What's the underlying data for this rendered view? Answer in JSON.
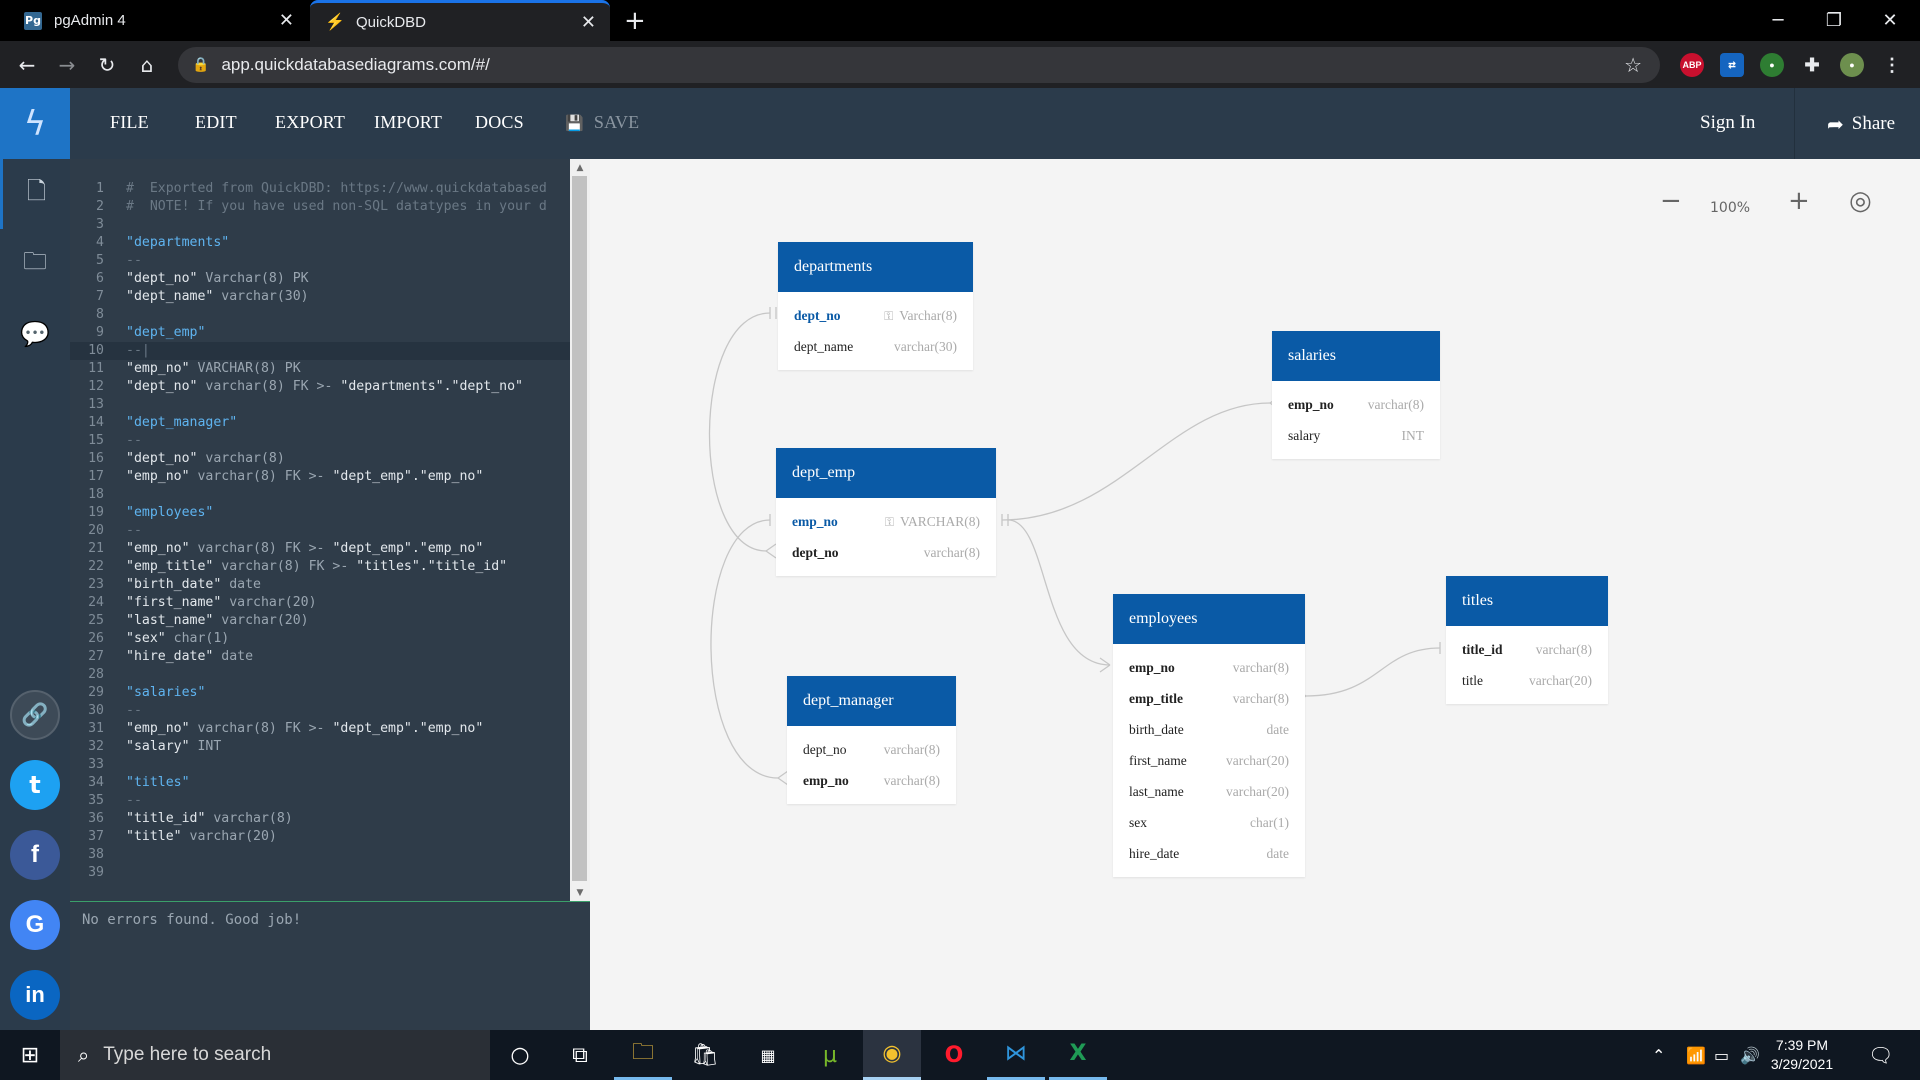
{
  "browser": {
    "tabs": [
      {
        "label": "pgAdmin 4",
        "favicon": "pg"
      },
      {
        "label": "QuickDBD",
        "favicon": "quickdbd-bolt"
      }
    ],
    "url": "app.quickdatabasediagrams.com/#/"
  },
  "app": {
    "menu": {
      "file": "FILE",
      "edit": "EDIT",
      "export": "EXPORT",
      "import": "IMPORT",
      "docs": "DOCS",
      "save": "SAVE"
    },
    "sign_in": "Sign In",
    "share": "Share",
    "accent_color": "#1e74c6",
    "header_color": "#2b3b4b",
    "table_header_color": "#0a5aa6"
  },
  "editor": {
    "lines": [
      [
        [
          "com",
          "#  Exported from QuickDBD: https://www.quickdatabased"
        ]
      ],
      [
        [
          "com",
          "#  NOTE! If you have used non-SQL datatypes in your d"
        ]
      ],
      [],
      [
        [
          "tbl",
          "\"departments\""
        ]
      ],
      [
        [
          "dash",
          "--"
        ]
      ],
      [
        [
          "str",
          "\"dept_no\" "
        ],
        [
          "type",
          "Varchar(8) PK"
        ]
      ],
      [
        [
          "str",
          "\"dept_name\" "
        ],
        [
          "type",
          "varchar(30)"
        ]
      ],
      [],
      [
        [
          "tbl",
          "\"dept_emp\""
        ]
      ],
      [
        [
          "dash",
          "--|"
        ]
      ],
      [
        [
          "str",
          "\"emp_no\" "
        ],
        [
          "type",
          "VARCHAR(8) PK"
        ]
      ],
      [
        [
          "str",
          "\"dept_no\" "
        ],
        [
          "type",
          "varchar(8) FK >- "
        ],
        [
          "str",
          "\"departments\".\"dept_no\""
        ]
      ],
      [],
      [
        [
          "tbl",
          "\"dept_manager\""
        ]
      ],
      [
        [
          "dash",
          "--"
        ]
      ],
      [
        [
          "str",
          "\"dept_no\" "
        ],
        [
          "type",
          "varchar(8)"
        ]
      ],
      [
        [
          "str",
          "\"emp_no\" "
        ],
        [
          "type",
          "varchar(8) FK >- "
        ],
        [
          "str",
          "\"dept_emp\".\"emp_no\""
        ]
      ],
      [],
      [
        [
          "tbl",
          "\"employees\""
        ]
      ],
      [
        [
          "dash",
          "--"
        ]
      ],
      [
        [
          "str",
          "\"emp_no\" "
        ],
        [
          "type",
          "varchar(8) FK >- "
        ],
        [
          "str",
          "\"dept_emp\".\"emp_no\""
        ]
      ],
      [
        [
          "str",
          "\"emp_title\" "
        ],
        [
          "type",
          "varchar(8) FK >- "
        ],
        [
          "str",
          "\"titles\".\"title_id\""
        ]
      ],
      [
        [
          "str",
          "\"birth_date\" "
        ],
        [
          "type",
          "date"
        ]
      ],
      [
        [
          "str",
          "\"first_name\" "
        ],
        [
          "type",
          "varchar(20)"
        ]
      ],
      [
        [
          "str",
          "\"last_name\" "
        ],
        [
          "type",
          "varchar(20)"
        ]
      ],
      [
        [
          "str",
          "\"sex\" "
        ],
        [
          "type",
          "char(1)"
        ]
      ],
      [
        [
          "str",
          "\"hire_date\" "
        ],
        [
          "type",
          "date"
        ]
      ],
      [],
      [
        [
          "tbl",
          "\"salaries\""
        ]
      ],
      [
        [
          "dash",
          "--"
        ]
      ],
      [
        [
          "str",
          "\"emp_no\" "
        ],
        [
          "type",
          "varchar(8) FK >- "
        ],
        [
          "str",
          "\"dept_emp\".\"emp_no\""
        ]
      ],
      [
        [
          "str",
          "\"salary\" "
        ],
        [
          "type",
          "INT"
        ]
      ],
      [],
      [
        [
          "tbl",
          "\"titles\""
        ]
      ],
      [
        [
          "dash",
          "--"
        ]
      ],
      [
        [
          "str",
          "\"title_id\" "
        ],
        [
          "type",
          "varchar(8)"
        ]
      ],
      [
        [
          "str",
          "\"title\" "
        ],
        [
          "type",
          "varchar(20)"
        ]
      ],
      [],
      []
    ],
    "highlighted_line": 10,
    "status_message": "No errors found. Good job!"
  },
  "canvas": {
    "zoom": "100%",
    "tables": {
      "departments": {
        "name": "departments",
        "fields": [
          {
            "name": "dept_no",
            "type": "Varchar(8)",
            "pk": true
          },
          {
            "name": "dept_name",
            "type": "varchar(30)"
          }
        ]
      },
      "dept_emp": {
        "name": "dept_emp",
        "fields": [
          {
            "name": "emp_no",
            "type": "VARCHAR(8)",
            "pk": true
          },
          {
            "name": "dept_no",
            "type": "varchar(8)",
            "bold": true
          }
        ]
      },
      "dept_manager": {
        "name": "dept_manager",
        "fields": [
          {
            "name": "dept_no",
            "type": "varchar(8)"
          },
          {
            "name": "emp_no",
            "type": "varchar(8)",
            "bold": true
          }
        ]
      },
      "salaries": {
        "name": "salaries",
        "fields": [
          {
            "name": "emp_no",
            "type": "varchar(8)",
            "bold": true
          },
          {
            "name": "salary",
            "type": "INT"
          }
        ]
      },
      "employees": {
        "name": "employees",
        "fields": [
          {
            "name": "emp_no",
            "type": "varchar(8)",
            "bold": true
          },
          {
            "name": "emp_title",
            "type": "varchar(8)",
            "bold": true
          },
          {
            "name": "birth_date",
            "type": "date"
          },
          {
            "name": "first_name",
            "type": "varchar(20)"
          },
          {
            "name": "last_name",
            "type": "varchar(20)"
          },
          {
            "name": "sex",
            "type": "char(1)"
          },
          {
            "name": "hire_date",
            "type": "date"
          }
        ]
      },
      "titles": {
        "name": "titles",
        "fields": [
          {
            "name": "title_id",
            "type": "varchar(8)",
            "bold": true
          },
          {
            "name": "title",
            "type": "varchar(20)"
          }
        ]
      }
    }
  },
  "taskbar": {
    "search_placeholder": "Type here to search",
    "time": "7:39 PM",
    "date": "3/29/2021"
  }
}
